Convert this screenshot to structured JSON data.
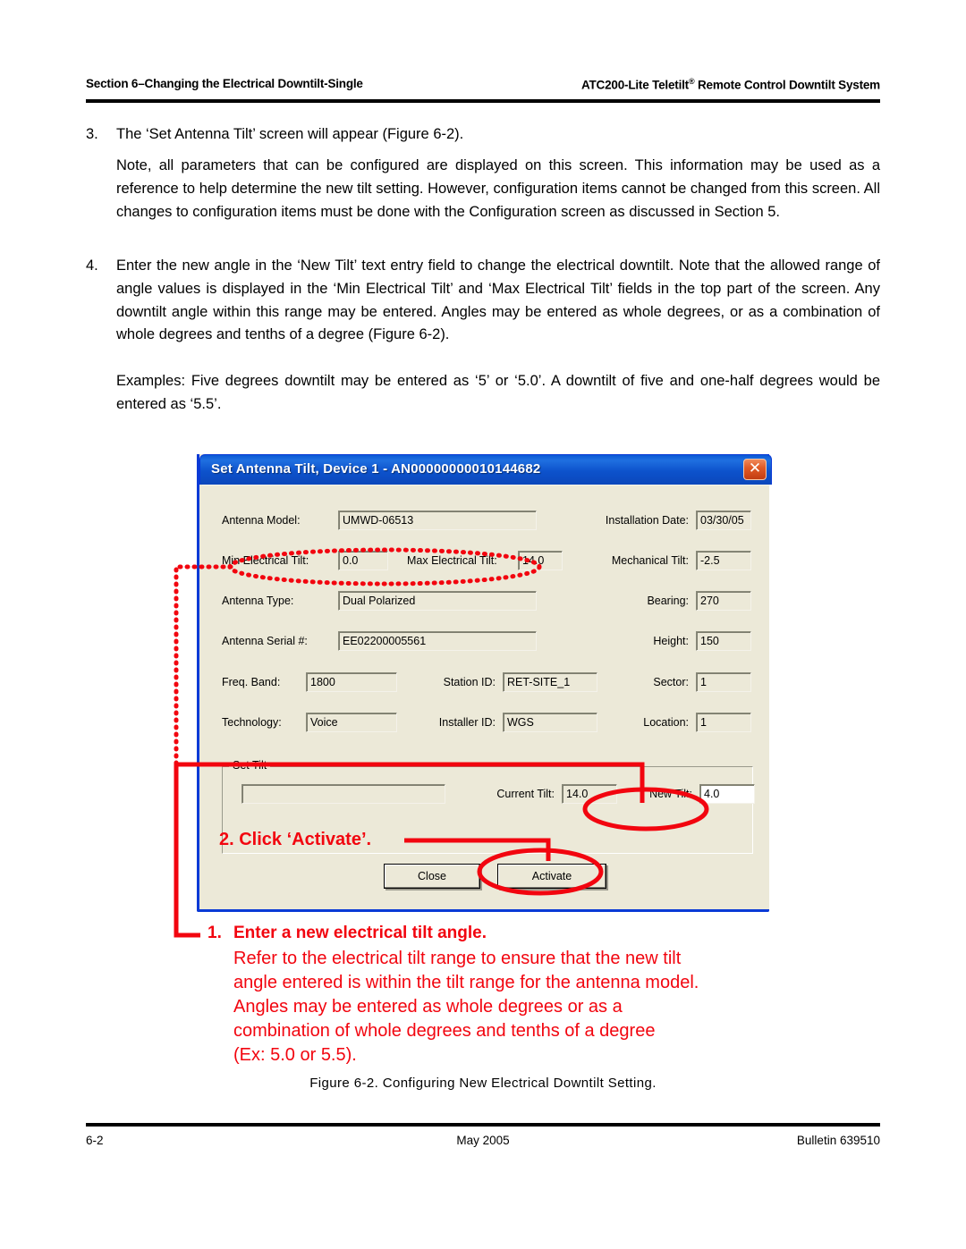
{
  "header": {
    "left": "Section 6–Changing the Electrical Downtilt-Single",
    "right_main": "ATC200-Lite Teletilt",
    "right_sup": "®",
    "right_tail": " Remote Control Downtilt System"
  },
  "body": {
    "item3_num": "3.",
    "item3_text": "The ‘Set Antenna Tilt’ screen will appear (Figure 6-2).",
    "note_text": "Note, all parameters that can be configured are displayed on this screen. This information may be used as a reference to help determine the new tilt setting. However, configuration items cannot be changed from this screen. All changes to configuration items must be done with the Configuration screen as discussed in Section 5.",
    "item4_num": "4.",
    "item4_text": "Enter the new angle in the ‘New Tilt’ text entry field to change the electrical downtilt. Note that the allowed range of angle values is displayed in the ‘Min Electrical Tilt’ and ‘Max Electrical Tilt’ fields in the top part of the screen. Any downtilt angle within this range may be entered. Angles may be entered as whole degrees, or as a combination of whole degrees and tenths of a degree (Figure 6-2).",
    "examples_text": "Examples: Five degrees downtilt may be entered as ‘5’ or ‘5.0’. A downtilt of five and one-half degrees would be entered as ‘5.5’."
  },
  "dialog": {
    "title": "Set Antenna Tilt, Device 1 - AN00000000010144682",
    "close_glyph": "✕",
    "fields": {
      "antenna_model_label": "Antenna Model:",
      "antenna_model_value": "UMWD-06513",
      "installation_date_label": "Installation Date:",
      "installation_date_value": "03/30/05",
      "min_electrical_tilt_label": "Min Electrical Tilt:",
      "min_electrical_tilt_value": "0.0",
      "max_electrical_tilt_label": "Max Electrical Tilt:",
      "max_electrical_tilt_value": "14.0",
      "mechanical_tilt_label": "Mechanical Tilt:",
      "mechanical_tilt_value": "-2.5",
      "antenna_type_label": "Antenna Type:",
      "antenna_type_value": "Dual Polarized",
      "bearing_label": "Bearing:",
      "bearing_value": "270",
      "antenna_serial_label": "Antenna Serial #:",
      "antenna_serial_value": "EE02200005561",
      "height_label": "Height:",
      "height_value": "150",
      "freq_band_label": "Freq. Band:",
      "freq_band_value": "1800",
      "station_id_label": "Station ID:",
      "station_id_value": "RET-SITE_1",
      "sector_label": "Sector:",
      "sector_value": "1",
      "technology_label": "Technology:",
      "technology_value": "Voice",
      "installer_id_label": "Installer ID:",
      "installer_id_value": "WGS",
      "location_label": "Location:",
      "location_value": "1"
    },
    "set_tilt": {
      "legend": "Set Tilt",
      "status_value": "",
      "current_tilt_label": "Current Tilt:",
      "current_tilt_value": "14.0",
      "new_tilt_label": "New Tilt:",
      "new_tilt_value": "4.0"
    },
    "buttons": {
      "close": "Close",
      "activate": "Activate"
    }
  },
  "annotations": {
    "step2": "2. Click ‘Activate’.",
    "step1_num": "1.",
    "step1_title": "Enter a new electrical tilt angle.",
    "step1_l1": "Refer to the electrical tilt range to ensure that the new tilt",
    "step1_l2": "angle entered is within the tilt range for the antenna model.",
    "step1_l3": "Angles may be entered as whole degrees or as a",
    "step1_l4": "combination of whole degrees and tenths of a degree",
    "step1_l5": "(Ex: 5.0 or 5.5).",
    "color": "#f2050f"
  },
  "caption": "Figure 6-2. Configuring New Electrical Downtilt Setting.",
  "footer": {
    "left": "6-2",
    "center": "May 2005",
    "right": "Bulletin 639510"
  }
}
